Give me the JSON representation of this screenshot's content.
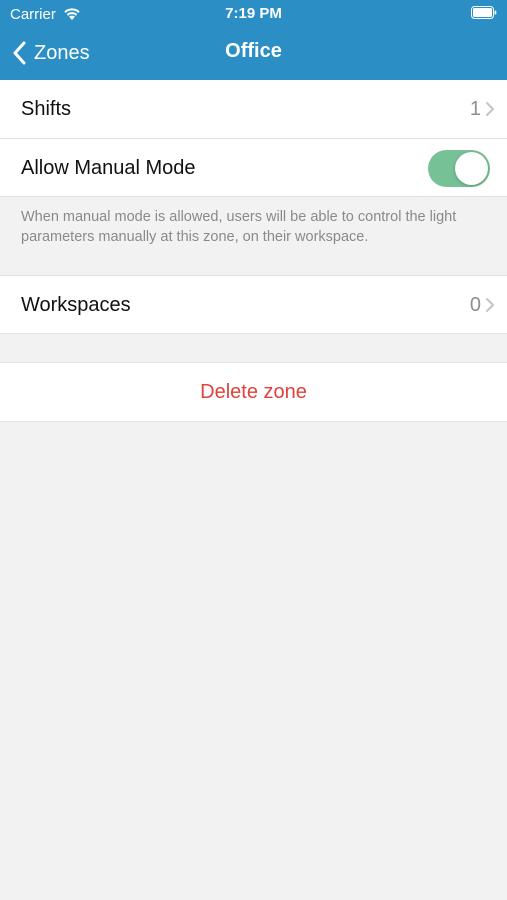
{
  "status_bar": {
    "carrier": "Carrier",
    "time": "7:19 PM"
  },
  "nav": {
    "back_label": "Zones",
    "title": "Office"
  },
  "rows": {
    "shifts": {
      "label": "Shifts",
      "value": "1"
    },
    "manual_mode": {
      "label": "Allow Manual Mode",
      "enabled": true
    },
    "workspaces": {
      "label": "Workspaces",
      "value": "0"
    }
  },
  "footnote": "When manual mode is allowed, users will be able to control the light parameters manually at this zone, on their workspace.",
  "delete_label": "Delete zone",
  "colors": {
    "nav_background": "#2b8fc6",
    "toggle_on": "#77c196",
    "destructive": "#e0413b",
    "background": "#f2f2f2"
  },
  "icons": [
    "wifi-icon",
    "battery-icon",
    "chevron-left-icon",
    "chevron-right-icon"
  ]
}
